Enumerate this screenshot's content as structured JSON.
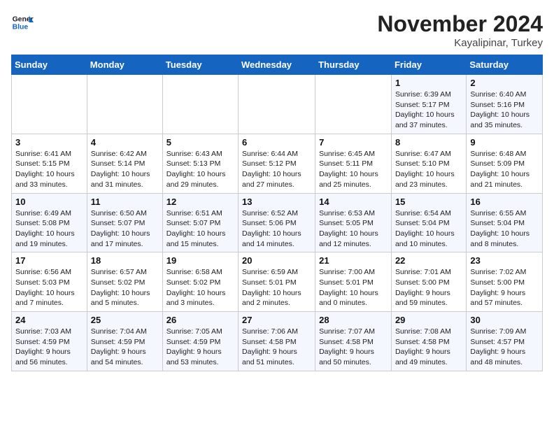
{
  "header": {
    "logo_line1": "General",
    "logo_line2": "Blue",
    "month": "November 2024",
    "location": "Kayalipinar, Turkey"
  },
  "weekdays": [
    "Sunday",
    "Monday",
    "Tuesday",
    "Wednesday",
    "Thursday",
    "Friday",
    "Saturday"
  ],
  "rows": [
    [
      {
        "day": "",
        "info": ""
      },
      {
        "day": "",
        "info": ""
      },
      {
        "day": "",
        "info": ""
      },
      {
        "day": "",
        "info": ""
      },
      {
        "day": "",
        "info": ""
      },
      {
        "day": "1",
        "info": "Sunrise: 6:39 AM\nSunset: 5:17 PM\nDaylight: 10 hours\nand 37 minutes."
      },
      {
        "day": "2",
        "info": "Sunrise: 6:40 AM\nSunset: 5:16 PM\nDaylight: 10 hours\nand 35 minutes."
      }
    ],
    [
      {
        "day": "3",
        "info": "Sunrise: 6:41 AM\nSunset: 5:15 PM\nDaylight: 10 hours\nand 33 minutes."
      },
      {
        "day": "4",
        "info": "Sunrise: 6:42 AM\nSunset: 5:14 PM\nDaylight: 10 hours\nand 31 minutes."
      },
      {
        "day": "5",
        "info": "Sunrise: 6:43 AM\nSunset: 5:13 PM\nDaylight: 10 hours\nand 29 minutes."
      },
      {
        "day": "6",
        "info": "Sunrise: 6:44 AM\nSunset: 5:12 PM\nDaylight: 10 hours\nand 27 minutes."
      },
      {
        "day": "7",
        "info": "Sunrise: 6:45 AM\nSunset: 5:11 PM\nDaylight: 10 hours\nand 25 minutes."
      },
      {
        "day": "8",
        "info": "Sunrise: 6:47 AM\nSunset: 5:10 PM\nDaylight: 10 hours\nand 23 minutes."
      },
      {
        "day": "9",
        "info": "Sunrise: 6:48 AM\nSunset: 5:09 PM\nDaylight: 10 hours\nand 21 minutes."
      }
    ],
    [
      {
        "day": "10",
        "info": "Sunrise: 6:49 AM\nSunset: 5:08 PM\nDaylight: 10 hours\nand 19 minutes."
      },
      {
        "day": "11",
        "info": "Sunrise: 6:50 AM\nSunset: 5:07 PM\nDaylight: 10 hours\nand 17 minutes."
      },
      {
        "day": "12",
        "info": "Sunrise: 6:51 AM\nSunset: 5:07 PM\nDaylight: 10 hours\nand 15 minutes."
      },
      {
        "day": "13",
        "info": "Sunrise: 6:52 AM\nSunset: 5:06 PM\nDaylight: 10 hours\nand 14 minutes."
      },
      {
        "day": "14",
        "info": "Sunrise: 6:53 AM\nSunset: 5:05 PM\nDaylight: 10 hours\nand 12 minutes."
      },
      {
        "day": "15",
        "info": "Sunrise: 6:54 AM\nSunset: 5:04 PM\nDaylight: 10 hours\nand 10 minutes."
      },
      {
        "day": "16",
        "info": "Sunrise: 6:55 AM\nSunset: 5:04 PM\nDaylight: 10 hours\nand 8 minutes."
      }
    ],
    [
      {
        "day": "17",
        "info": "Sunrise: 6:56 AM\nSunset: 5:03 PM\nDaylight: 10 hours\nand 7 minutes."
      },
      {
        "day": "18",
        "info": "Sunrise: 6:57 AM\nSunset: 5:02 PM\nDaylight: 10 hours\nand 5 minutes."
      },
      {
        "day": "19",
        "info": "Sunrise: 6:58 AM\nSunset: 5:02 PM\nDaylight: 10 hours\nand 3 minutes."
      },
      {
        "day": "20",
        "info": "Sunrise: 6:59 AM\nSunset: 5:01 PM\nDaylight: 10 hours\nand 2 minutes."
      },
      {
        "day": "21",
        "info": "Sunrise: 7:00 AM\nSunset: 5:01 PM\nDaylight: 10 hours\nand 0 minutes."
      },
      {
        "day": "22",
        "info": "Sunrise: 7:01 AM\nSunset: 5:00 PM\nDaylight: 9 hours\nand 59 minutes."
      },
      {
        "day": "23",
        "info": "Sunrise: 7:02 AM\nSunset: 5:00 PM\nDaylight: 9 hours\nand 57 minutes."
      }
    ],
    [
      {
        "day": "24",
        "info": "Sunrise: 7:03 AM\nSunset: 4:59 PM\nDaylight: 9 hours\nand 56 minutes."
      },
      {
        "day": "25",
        "info": "Sunrise: 7:04 AM\nSunset: 4:59 PM\nDaylight: 9 hours\nand 54 minutes."
      },
      {
        "day": "26",
        "info": "Sunrise: 7:05 AM\nSunset: 4:59 PM\nDaylight: 9 hours\nand 53 minutes."
      },
      {
        "day": "27",
        "info": "Sunrise: 7:06 AM\nSunset: 4:58 PM\nDaylight: 9 hours\nand 51 minutes."
      },
      {
        "day": "28",
        "info": "Sunrise: 7:07 AM\nSunset: 4:58 PM\nDaylight: 9 hours\nand 50 minutes."
      },
      {
        "day": "29",
        "info": "Sunrise: 7:08 AM\nSunset: 4:58 PM\nDaylight: 9 hours\nand 49 minutes."
      },
      {
        "day": "30",
        "info": "Sunrise: 7:09 AM\nSunset: 4:57 PM\nDaylight: 9 hours\nand 48 minutes."
      }
    ]
  ]
}
